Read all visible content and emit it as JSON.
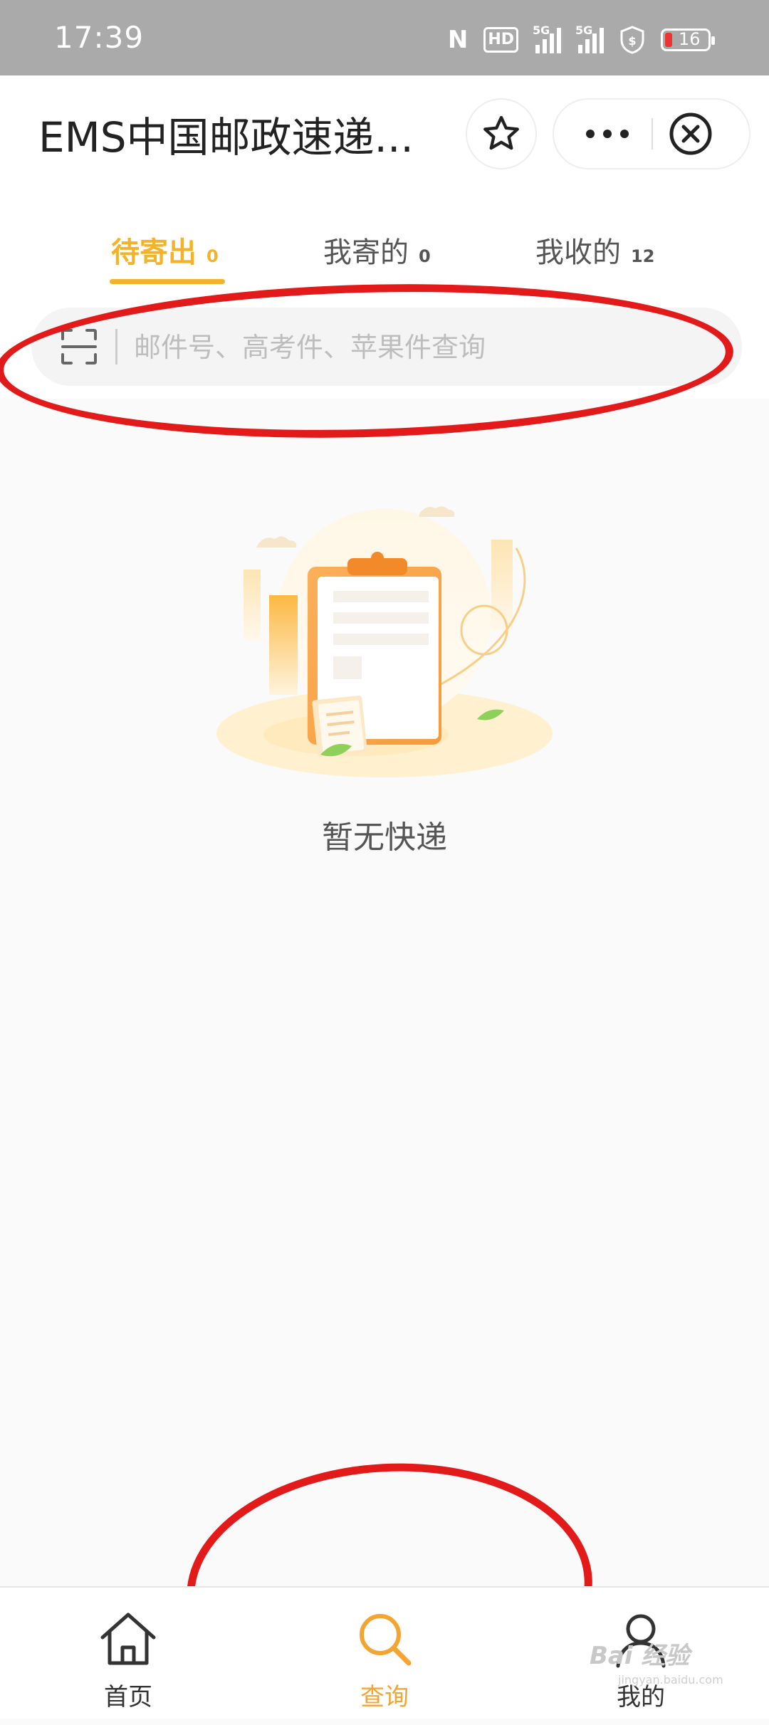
{
  "status_bar": {
    "time": "17:39",
    "nfc_label": "N",
    "hd_label": "HD",
    "signal1_label": "5G",
    "signal2_label": "5G",
    "battery_level": "16"
  },
  "header": {
    "title": "EMS中国邮政速递...",
    "favorite_icon": "star-icon",
    "more_icon": "more-icon",
    "close_icon": "close-circle-icon"
  },
  "tabs": [
    {
      "label": "待寄出",
      "count": "0",
      "active": true
    },
    {
      "label": "我寄的",
      "count": "0",
      "active": false
    },
    {
      "label": "我收的",
      "count": "12",
      "active": false
    }
  ],
  "search": {
    "placeholder": "邮件号、高考件、苹果件查询",
    "scan_icon": "scan-icon"
  },
  "empty_state": {
    "illustration": "clipboard-illustration",
    "text": "暂无快递"
  },
  "bottom_nav": [
    {
      "label": "首页",
      "icon": "home-icon",
      "active": false
    },
    {
      "label": "查询",
      "icon": "search-icon",
      "active": true
    },
    {
      "label": "我的",
      "icon": "user-icon",
      "active": false
    }
  ],
  "watermark": {
    "text": "Bai 经验",
    "subtext": "jingyan.baidu.com"
  },
  "colors": {
    "accent": "#f3b227",
    "annotation": "#e21a1a",
    "status_bar_bg": "#aaaaaa"
  }
}
